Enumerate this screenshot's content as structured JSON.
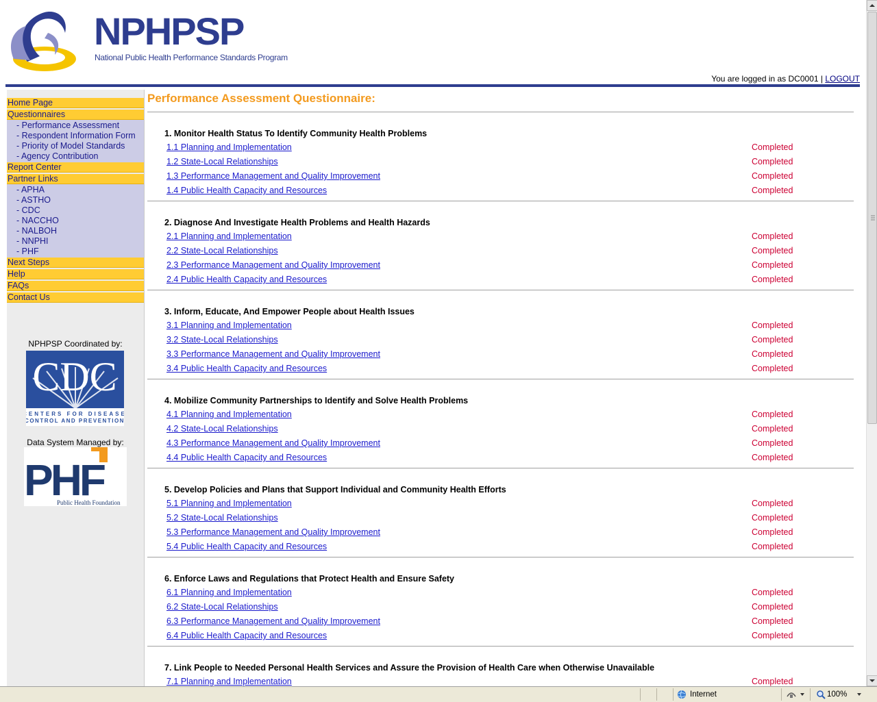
{
  "header": {
    "brand": "NPHPSP",
    "subtitle": "National Public Health Performance Standards Program",
    "login_prefix": "You are logged in as DC0001 | ",
    "logout": "LOGOUT"
  },
  "sidebar": {
    "home": "Home Page",
    "questionnaires": "Questionnaires",
    "questionnaire_items": [
      "- Performance Assessment",
      "- Respondent Information Form",
      "- Priority of Model Standards",
      "- Agency Contribution"
    ],
    "report_center": "Report Center",
    "partner_links": "Partner Links",
    "partner_items": [
      "- APHA",
      "- ASTHO",
      "- CDC",
      "- NACCHO",
      "- NALBOH",
      "- NNPHI",
      "- PHF"
    ],
    "next_steps": "Next Steps",
    "help": "Help",
    "faqs": "FAQs",
    "contact": "Contact Us",
    "coordinated_by": "NPHPSP Coordinated by:",
    "cdc_text": "CDC",
    "cdc_caption_1": "CENTERS FOR DISEASE",
    "cdc_caption_2": "CONTROL AND PREVENTION",
    "managed_by": "Data System Managed by:",
    "phf_text": "PHF",
    "phf_caption": "Public Health Foundation"
  },
  "main": {
    "title": "Performance Assessment Questionnaire:",
    "sections": [
      {
        "title": "1. Monitor Health Status To Identify Community Health Problems",
        "items": [
          {
            "label": "1.1 Planning and Implementation",
            "status": "Completed"
          },
          {
            "label": "1.2 State-Local Relationships",
            "status": "Completed"
          },
          {
            "label": "1.3 Performance Management and Quality Improvement",
            "status": "Completed"
          },
          {
            "label": "1.4 Public Health Capacity and Resources",
            "status": "Completed"
          }
        ]
      },
      {
        "title": "2. Diagnose And Investigate Health Problems and Health Hazards",
        "items": [
          {
            "label": "2.1 Planning and Implementation",
            "status": "Completed"
          },
          {
            "label": "2.2 State-Local Relationships",
            "status": "Completed"
          },
          {
            "label": "2.3 Performance Management and Quality Improvement",
            "status": "Completed"
          },
          {
            "label": "2.4 Public Health Capacity and Resources",
            "status": "Completed"
          }
        ]
      },
      {
        "title": "3. Inform, Educate, And Empower People about Health Issues",
        "items": [
          {
            "label": "3.1 Planning and Implementation",
            "status": "Completed"
          },
          {
            "label": "3.2 State-Local Relationships",
            "status": "Completed"
          },
          {
            "label": "3.3 Performance Management and Quality Improvement",
            "status": "Completed"
          },
          {
            "label": "3.4 Public Health Capacity and Resources",
            "status": "Completed"
          }
        ]
      },
      {
        "title": "4. Mobilize Community Partnerships to Identify and Solve Health Problems",
        "items": [
          {
            "label": "4.1 Planning and Implementation",
            "status": "Completed"
          },
          {
            "label": "4.2 State-Local Relationships",
            "status": "Completed"
          },
          {
            "label": "4.3 Performance Management and Quality Improvement",
            "status": "Completed"
          },
          {
            "label": "4.4 Public Health Capacity and Resources",
            "status": "Completed"
          }
        ]
      },
      {
        "title": "5. Develop Policies and Plans that Support Individual and Community Health Efforts",
        "items": [
          {
            "label": "5.1 Planning and Implementation",
            "status": "Completed"
          },
          {
            "label": "5.2 State-Local Relationships",
            "status": "Completed"
          },
          {
            "label": "5.3 Performance Management and Quality Improvement",
            "status": "Completed"
          },
          {
            "label": "5.4 Public Health Capacity and Resources",
            "status": "Completed"
          }
        ]
      },
      {
        "title": "6. Enforce Laws and Regulations that Protect Health and Ensure Safety",
        "items": [
          {
            "label": "6.1 Planning and Implementation",
            "status": "Completed"
          },
          {
            "label": "6.2 State-Local Relationships",
            "status": "Completed"
          },
          {
            "label": "6.3 Performance Management and Quality Improvement",
            "status": "Completed"
          },
          {
            "label": "6.4 Public Health Capacity and Resources",
            "status": "Completed"
          }
        ]
      },
      {
        "title": "7. Link People to Needed Personal Health Services and Assure the Provision of Health Care when Otherwise Unavailable",
        "items": [
          {
            "label": "7.1 Planning and Implementation",
            "status": "Completed"
          }
        ]
      }
    ]
  },
  "statusbar": {
    "zone": "Internet",
    "zoom": "100%"
  }
}
